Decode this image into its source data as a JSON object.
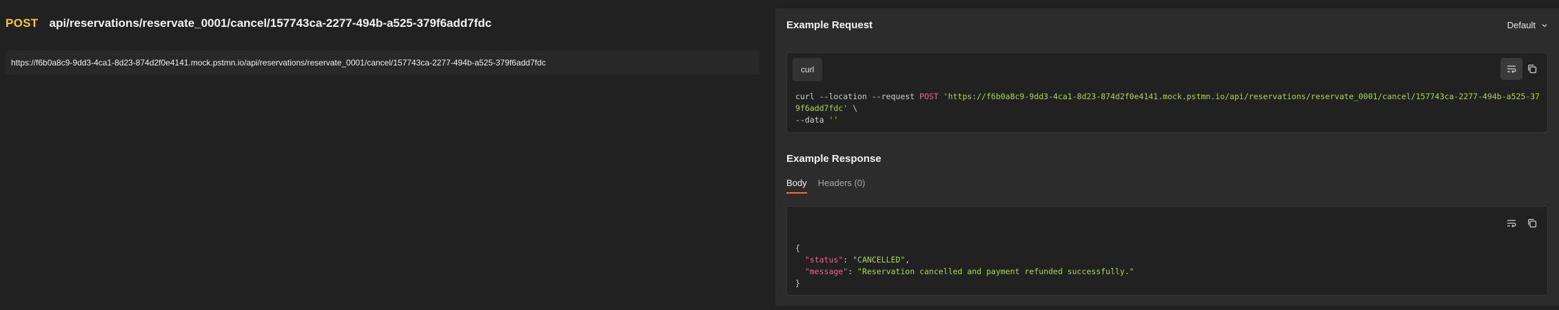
{
  "request": {
    "method": "POST",
    "path": "api/reservations/reservate_0001/cancel/157743ca-2277-494b-a525-379f6add7fdc",
    "url": "https://f6b0a8c9-9dd3-4ca1-8d23-874d2f0e4141.mock.pstmn.io/api/reservations/reservate_0001/cancel/157743ca-2277-494b-a525-379f6add7fdc"
  },
  "example_request": {
    "title": "Example Request",
    "selector_value": "Default",
    "language": "curl",
    "code": {
      "cmd": "curl --location --request ",
      "method": "POST",
      "space": " ",
      "url_part1": "'https://f6b0a8c9-9dd3-4ca1-8d23-874d2f0e4141.mock.pstmn.io/api/reservations/reservate_0001/cancel/157743ca-2277-494b-a525-379f6add7fdc'",
      "continuation": " \\",
      "data_flag": "--data ",
      "data_value": "''"
    }
  },
  "example_response": {
    "title": "Example Response",
    "tabs": [
      "Body",
      "Headers (0)"
    ],
    "active_tab": "Body",
    "body": {
      "open": "{",
      "close": "}",
      "status_key": "\"status\"",
      "status_value": "\"CANCELLED\"",
      "message_key": "\"message\"",
      "message_value": "\"Reservation cancelled and payment refunded successfully.\"",
      "colon": ": ",
      "comma": ","
    }
  },
  "icons": {
    "wrap": "wrap-lines-icon",
    "copy": "copy-icon",
    "chevron": "chevron-down-icon"
  },
  "colors": {
    "method": "#f5c642",
    "accent": "#f26b3a",
    "code_keyword": "#f06292",
    "code_string": "#a6d94a"
  }
}
